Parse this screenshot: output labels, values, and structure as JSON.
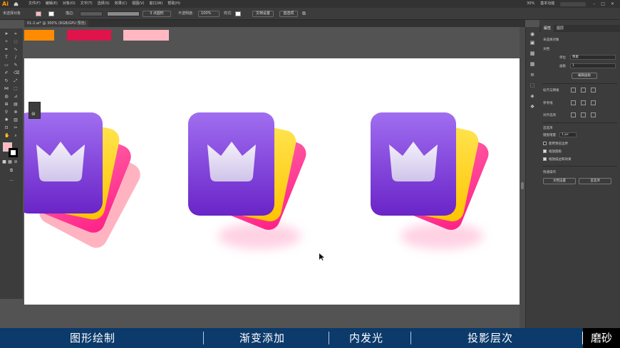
{
  "app": {
    "logo": "Ai"
  },
  "menubar": {
    "items": [
      "文件(F)",
      "编辑(E)",
      "对象(O)",
      "文字(T)",
      "选择(S)",
      "效果(C)",
      "视图(V)",
      "窗口(W)",
      "帮助(H)"
    ],
    "workspace": "基本功能",
    "zoom_label": "30%"
  },
  "controlbar": {
    "selection": "未选择对象",
    "stroke_label": "描边:",
    "brush": "3 点圆形",
    "opacity_label": "不透明度:",
    "opacity_value": "100%",
    "style_label": "样式:",
    "doc_setup": "文档设置",
    "prefs": "首选项"
  },
  "document": {
    "tab": "01-2.ai* @ 300% (RGB/GPU 预览)"
  },
  "swatches": {
    "orange": "#ff8c00",
    "crimson": "#e0134a",
    "pink": "#ffb8c1"
  },
  "panel": {
    "tabs": [
      "属性",
      "图层"
    ],
    "no_selection": "未选择对象",
    "doc_section": "文档",
    "units_label": "单位",
    "units_value": "像素",
    "artboard_label": "画板",
    "artboard_value": "1",
    "edit_artboard": "编辑画板",
    "ruler_grid": "标尺与网格",
    "guides": "参考线",
    "align": "对齐选项",
    "prefs_section": "首选项",
    "keyboard_inc": "键盘增量",
    "keyboard_value": "1 px",
    "opt1": "使用预览边界",
    "opt2": "缩放圆角",
    "opt3": "缩放描边和效果",
    "quick_actions": "快速操作",
    "btn_doc_setup": "文档设置",
    "btn_prefs": "首选项"
  },
  "footer": {
    "steps": [
      "图形绘制",
      "渐变添加",
      "内发光",
      "投影层次"
    ],
    "active": "磨砂"
  },
  "colors": {
    "purple_top": "#a06ef0",
    "purple_bottom": "#6a24c8",
    "yellow": "#ffd81a",
    "magenta": "#ff2d8a",
    "crown": "#e8e2f4",
    "footer_bg": "#0b3a6b"
  }
}
